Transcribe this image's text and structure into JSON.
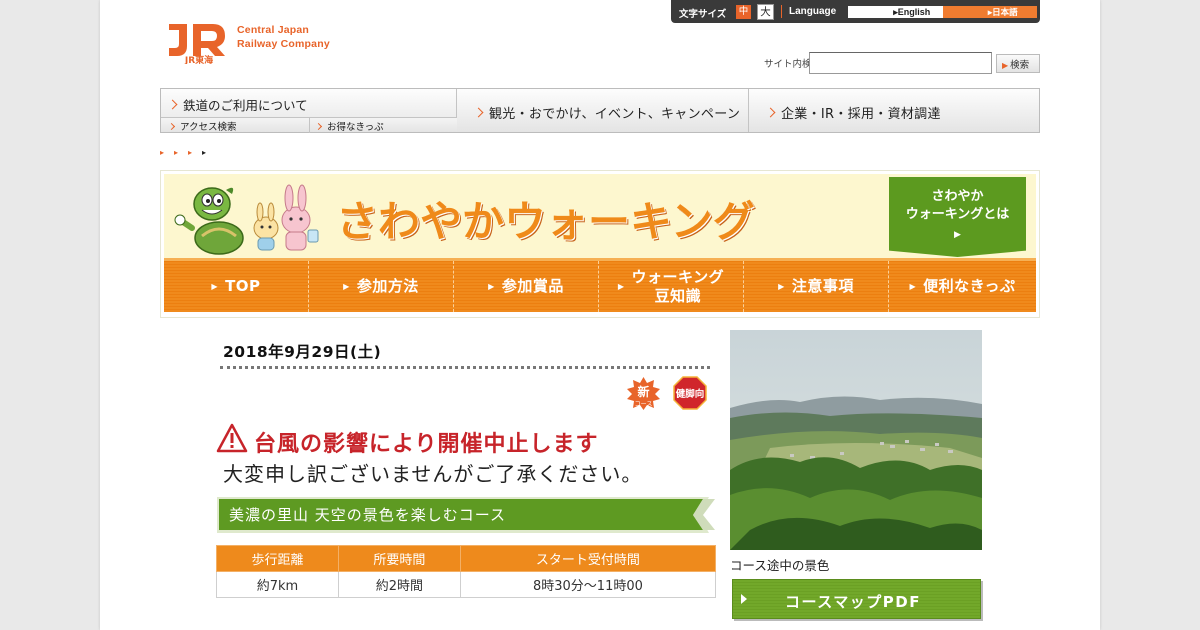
{
  "brand": {
    "logo_text": "JR東海",
    "company_line1": "Central Japan",
    "company_line2": "Railway Company",
    "colors": {
      "accent": "#e8642a",
      "orange": "#ee8a1c",
      "green": "#5c9a1f",
      "red": "#c7242a"
    }
  },
  "topbar": {
    "font_size_label": "文字サイズ",
    "font_mid": "中",
    "font_large": "大",
    "language_label": "Language",
    "english": "English",
    "japanese": "日本語"
  },
  "search": {
    "label": "サイト内検索",
    "placeholder": "",
    "value": "",
    "button": "検索"
  },
  "global_nav": {
    "rail_label": "鉄道のご利用について",
    "sub_items": [
      "アクセス検索",
      "お得なきっぷ"
    ],
    "tourism_label": "観光・おでかけ、イベント、キャンペーン",
    "corporate_label": "企業・IR・採用・資材調達"
  },
  "breadcrumb": {
    "items": [
      "▸",
      "▸",
      "▸",
      "▸"
    ]
  },
  "banner": {
    "title": "さわやかウォーキング",
    "about_line1": "さわやか",
    "about_line2": "ウォーキングとは",
    "about_arrow": "▶",
    "nav": [
      {
        "line1": "TOP",
        "line2": ""
      },
      {
        "line1": "参加方法",
        "line2": ""
      },
      {
        "line1": "参加賞品",
        "line2": ""
      },
      {
        "line1": "ウォーキング",
        "line2": "豆知識"
      },
      {
        "line1": "注意事項",
        "line2": ""
      },
      {
        "line1": "便利なきっぷ",
        "line2": ""
      }
    ]
  },
  "event": {
    "date": "2018年9月29日(土)",
    "badge_new_line1": "新",
    "badge_new_line2": "コース",
    "badge_health": "健脚向",
    "warning_text": "台風の影響により開催中止します",
    "notice_text": "大変申し訳ございませんがご了承ください。",
    "course_title": "美濃の里山 天空の景色を楽しむコース",
    "table": {
      "headers": [
        "歩行距離",
        "所要時間",
        "スタート受付時間"
      ],
      "values": [
        "約7km",
        "約2時間",
        "8時30分～11時00"
      ]
    },
    "photo_caption": "コース途中の景色",
    "pdf_button": "コースマップPDF",
    "icons": [
      "warning-icon",
      "new-course-badge",
      "healthy-legs-badge",
      "play-icon"
    ]
  }
}
